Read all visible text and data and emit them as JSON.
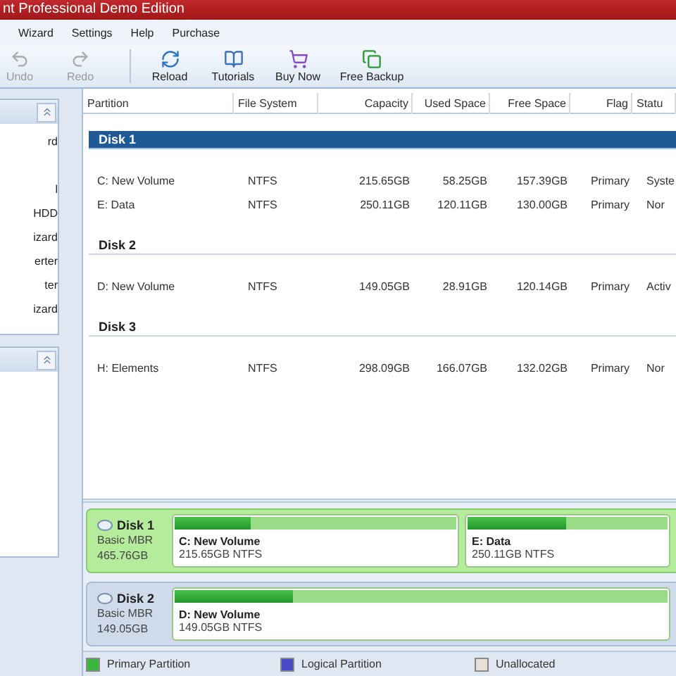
{
  "window": {
    "title": "nt Professional Demo Edition"
  },
  "menu": [
    "Wizard",
    "Settings",
    "Help",
    "Purchase"
  ],
  "toolbar": [
    {
      "kind": "undo",
      "label": "Undo",
      "disabled": true
    },
    {
      "kind": "redo",
      "label": "Redo",
      "disabled": true
    },
    {
      "kind": "reload",
      "label": "Reload",
      "disabled": false
    },
    {
      "kind": "tutorials",
      "label": "Tutorials",
      "disabled": false
    },
    {
      "kind": "buy",
      "label": "Buy Now",
      "disabled": false
    },
    {
      "kind": "backup",
      "label": "Free Backup",
      "disabled": false
    }
  ],
  "sidebar": {
    "panels": [
      {
        "items": [
          "rd",
          "l",
          "HDD",
          "izard",
          "erter",
          "ter",
          "izard"
        ]
      }
    ]
  },
  "table": {
    "columns": [
      "Partition",
      "File System",
      "Capacity",
      "Used Space",
      "Free Space",
      "Flag",
      "Statu"
    ],
    "groups": [
      {
        "disk": "Disk 1",
        "selected": true,
        "rows": [
          [
            "C: New Volume",
            "NTFS",
            "215.65GB",
            "58.25GB",
            "157.39GB",
            "Primary",
            "Syste"
          ],
          [
            "E: Data",
            "NTFS",
            "250.11GB",
            "120.11GB",
            "130.00GB",
            "Primary",
            "Nor"
          ]
        ]
      },
      {
        "disk": "Disk 2",
        "selected": false,
        "rows": [
          [
            "D: New Volume",
            "NTFS",
            "149.05GB",
            "28.91GB",
            "120.14GB",
            "Primary",
            "Activ"
          ]
        ]
      },
      {
        "disk": "Disk 3",
        "selected": false,
        "rows": [
          [
            "H: Elements",
            "NTFS",
            "298.09GB",
            "166.07GB",
            "132.02GB",
            "Primary",
            "Nor"
          ]
        ]
      }
    ]
  },
  "disk_map": [
    {
      "name": "Disk 1",
      "type": "Basic MBR",
      "size": "465.76GB",
      "selected": true,
      "partitions": [
        {
          "name": "C: New Volume",
          "info": "215.65GB NTFS",
          "level": 0.27
        },
        {
          "name": "E: Data",
          "info": "250.11GB NTFS",
          "level": 0.49
        }
      ]
    },
    {
      "name": "Disk 2",
      "type": "Basic MBR",
      "size": "149.05GB",
      "selected": false,
      "partitions": [
        {
          "name": "D: New Volume",
          "info": "149.05GB NTFS",
          "level": 0.24
        }
      ]
    }
  ],
  "legend": [
    {
      "label": "Primary Partition",
      "color": "#3cb43c"
    },
    {
      "label": "Logical Partition",
      "color": "#4848c8"
    },
    {
      "label": "Unallocated",
      "color": "#e8e0d8"
    }
  ]
}
